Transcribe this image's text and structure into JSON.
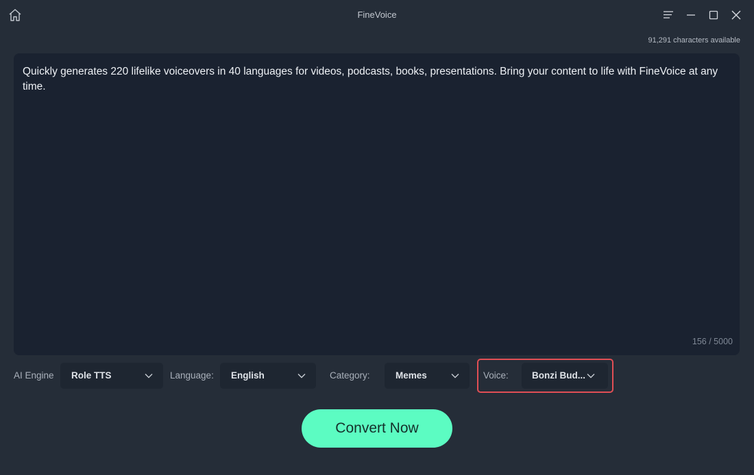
{
  "window": {
    "title": "FineVoice",
    "icons": {
      "home": "home-icon",
      "menu": "hamburger-menu-icon",
      "minimize": "minimize-icon",
      "maximize": "maximize-icon",
      "close": "close-icon"
    }
  },
  "editor": {
    "characters_available": "91,291 characters available",
    "text": "Quickly generates 220 lifelike voiceovers in 40 languages for videos, podcasts, books, presentations. Bring your content to life with FineVoice at any time.",
    "char_count": "156 / 5000"
  },
  "controls": {
    "ai_engine": {
      "label": "AI Engine",
      "value": "Role TTS"
    },
    "language": {
      "label": "Language:",
      "value": "English"
    },
    "category": {
      "label": "Category:",
      "value": "Memes"
    },
    "voice": {
      "label": "Voice:",
      "value": "Bonzi Bud..."
    }
  },
  "actions": {
    "convert_label": "Convert Now"
  },
  "colors": {
    "background": "#252d38",
    "editor_bg": "#1a2230",
    "accent": "#5cfcc2",
    "highlight": "#e24f55"
  }
}
